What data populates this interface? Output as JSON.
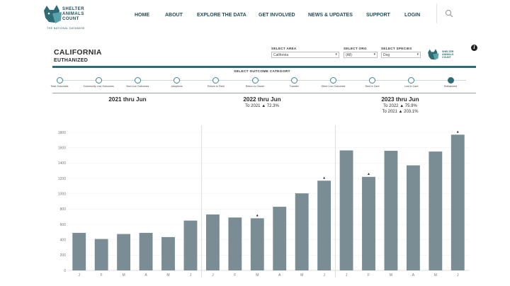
{
  "site": {
    "logo_lines": [
      "SHELTER",
      "ANIMALS",
      "COUNT"
    ],
    "logo_tagline": "THE NATIONAL DATABASE",
    "nav": [
      "HOME",
      "ABOUT",
      "EXPLORE THE DATA",
      "GET INVOLVED",
      "NEWS & UPDATES",
      "SUPPORT",
      "LOGIN"
    ]
  },
  "dashboard": {
    "area_title": "CALIFORNIA",
    "metric_title": "EUTHANIZED",
    "filters": [
      {
        "label": "SELECT AREA",
        "value": "California"
      },
      {
        "label": "SELECT ORG",
        "value": "(All)"
      },
      {
        "label": "SELECT SPECIES",
        "value": "Dog"
      }
    ],
    "mini_logo_lines": [
      "SHELTER",
      "ANIMALS",
      "COUNT"
    ],
    "outcome_title": "SELECT OUTCOME CATEGORY",
    "outcomes": [
      "Total Outcomes",
      "Community Live Outcomes",
      "Non-Live Outcomes",
      "Adoptions",
      "Return to Field",
      "Return to Owner",
      "Transfer",
      "Other Live Outcomes",
      "Died in Care",
      "Lost in Care",
      "Euthanized"
    ],
    "selected_outcome": "Euthanized",
    "periods": [
      {
        "title": "2021 thru Jun",
        "cmp": []
      },
      {
        "title": "2022 thru Jun",
        "cmp": [
          "To 2021 ▲ 72.3%"
        ]
      },
      {
        "title": "2023 thru Jun",
        "cmp": [
          "To 2022 ▲ 75.9%",
          "To 2021 ▲ 203.1%"
        ]
      }
    ]
  },
  "colors": {
    "teal": "#2f6b75",
    "bar": "#7a8d94"
  },
  "chart_data": {
    "type": "bar",
    "ylim": [
      0,
      1800
    ],
    "yticks": [
      0,
      200,
      400,
      600,
      800,
      1000,
      1200,
      1400,
      1600,
      1800
    ],
    "categories": [
      "J",
      "F",
      "M",
      "A",
      "M",
      "J",
      "J",
      "F",
      "M",
      "A",
      "M",
      "J",
      "J",
      "F",
      "M",
      "A",
      "M",
      "J"
    ],
    "groups": [
      "2021 thru Jun",
      "2022 thru Jun",
      "2023 thru Jun"
    ],
    "values": [
      490,
      410,
      475,
      490,
      435,
      650,
      730,
      690,
      680,
      830,
      1005,
      1170,
      1565,
      1220,
      1560,
      1370,
      1550,
      1770
    ],
    "increase_markers": [
      false,
      false,
      false,
      false,
      false,
      false,
      false,
      false,
      true,
      false,
      false,
      true,
      false,
      true,
      false,
      false,
      false,
      true
    ],
    "marker_glyph": "▲"
  }
}
